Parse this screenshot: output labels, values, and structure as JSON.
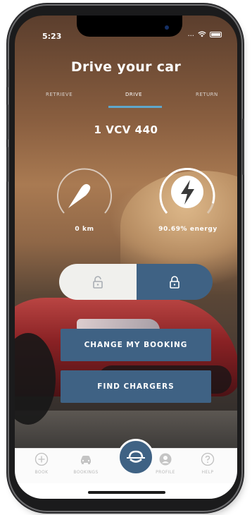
{
  "status_bar": {
    "time": "5:23",
    "signal": "...",
    "wifi_icon": "wifi-icon",
    "battery_icon": "battery-icon"
  },
  "header": {
    "title": "Drive your car"
  },
  "tabs": [
    {
      "label": "RETRIEVE",
      "active": false
    },
    {
      "label": "DRIVE",
      "active": true
    },
    {
      "label": "RETURN",
      "active": false
    }
  ],
  "vehicle": {
    "plate": "1 VCV 440",
    "distance_label": "0 km",
    "energy_label": "90.69% energy",
    "energy_fraction": 0.9069
  },
  "lock_toggle": {
    "unlock_icon": "unlock-icon",
    "lock_icon": "lock-icon",
    "selected": "lock"
  },
  "actions": {
    "change_booking": "CHANGE MY BOOKING",
    "find_chargers": "FIND CHARGERS"
  },
  "tabbar": {
    "items": [
      {
        "label": "BOOK",
        "icon": "plus-circle-icon"
      },
      {
        "label": "BOOKINGS",
        "icon": "car-icon"
      },
      {
        "label": "",
        "icon": "logo-icon"
      },
      {
        "label": "PROFILE",
        "icon": "profile-icon"
      },
      {
        "label": "HELP",
        "icon": "help-icon"
      }
    ]
  },
  "colors": {
    "accent": "#3f6284",
    "tab_indicator": "#5fa7cc",
    "tabbar_bg": "#fbfbfb"
  }
}
